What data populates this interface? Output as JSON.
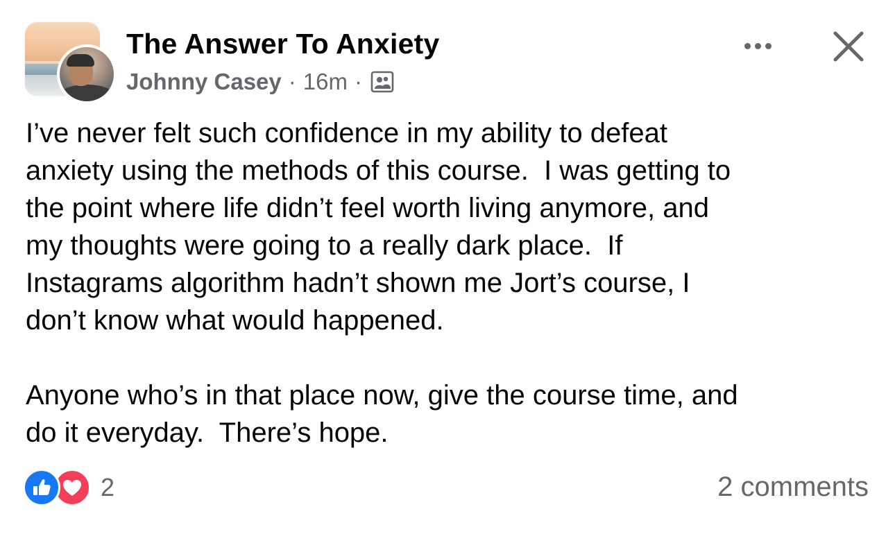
{
  "post": {
    "group_name": "The Answer To Anxiety",
    "author": "Johnny Casey",
    "separator": "·",
    "time": "16m",
    "audience_icon": "group-members-icon",
    "paragraphs": [
      "I’ve never felt such confidence in my ability to defeat\nanxiety using the methods of this course.  I was getting to\nthe point where life didn’t feel worth living anymore, and\nmy thoughts were going to a really dark place.  If\nInstagrams algorithm hadn’t shown me Jort’s course, I\ndon’t know what would happened.",
      "Anyone who’s in that place now, give the course time, and\ndo it everyday.  There’s hope."
    ]
  },
  "actions": {
    "more_icon": "more-options-icon",
    "close_icon": "close-icon"
  },
  "footer": {
    "reaction_icons": [
      "like-reaction-icon",
      "love-reaction-icon"
    ],
    "reaction_count": "2",
    "comments_label": "2 comments"
  },
  "colors": {
    "primary_text": "#050505",
    "secondary_text": "#65676b",
    "like_blue": "#1877f2",
    "love_red": "#f33e58"
  }
}
